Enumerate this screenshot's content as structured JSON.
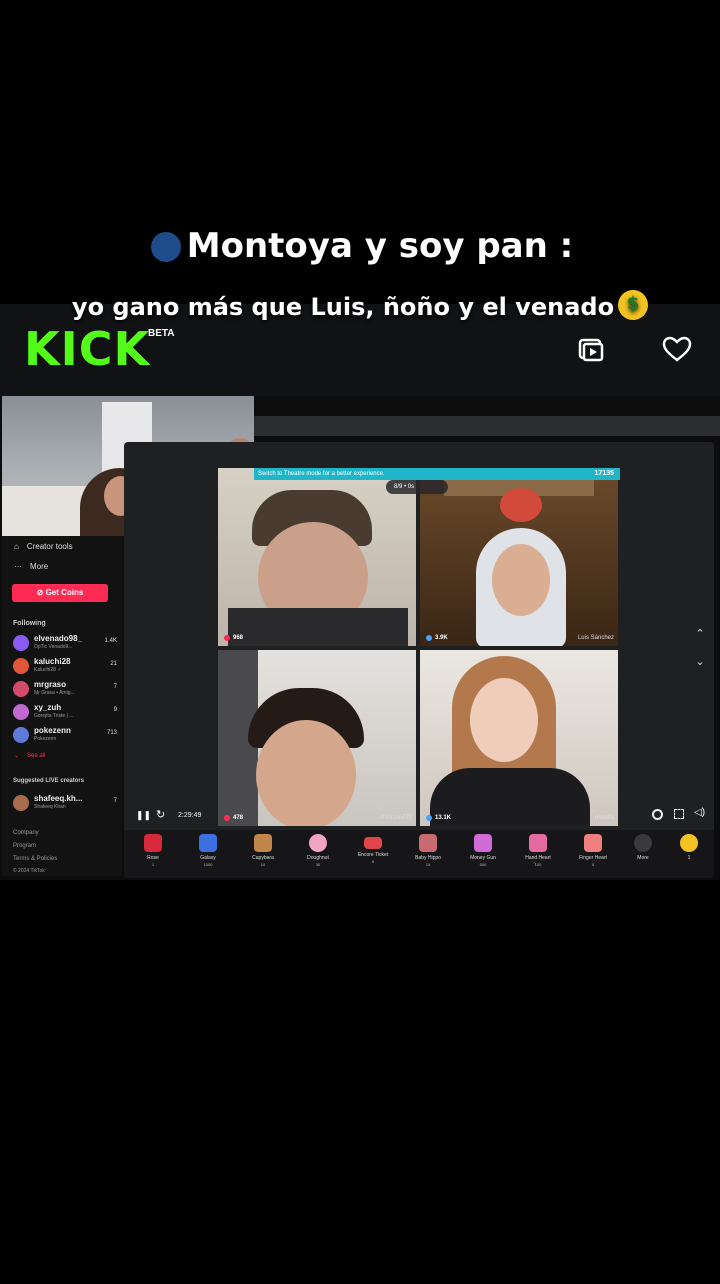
{
  "caption": {
    "line1": "Montoya y soy pan :",
    "line1_emoji": "speaking-head",
    "line2": "yo gano más que Luis, ñoño y el venado",
    "line2_emoji": "money-mouth-face"
  },
  "kick": {
    "logo": "KICK",
    "beta": "BETA",
    "icons": [
      "picture-in-picture-icon",
      "heart-icon"
    ],
    "accent": "#53fc18"
  },
  "sidebar": {
    "creator_tools": "Creator tools",
    "more": "More",
    "get_coins": "Get Coins",
    "following_heading": "Following",
    "following": [
      {
        "name": "elvenado98_",
        "sub": "OpTic Venado9...",
        "count": "1.4K",
        "color": "#8a5cf5"
      },
      {
        "name": "kaluchi28",
        "sub": "Kaluchi28 ✓",
        "count": "21",
        "color": "#e0563a"
      },
      {
        "name": "mrgraso",
        "sub": "Mr Grasa • Amig...",
        "count": "7",
        "color": "#d34b6a"
      },
      {
        "name": "xy_zuh",
        "sub": "Gorejita Triste | ...",
        "count": "9",
        "color": "#c06ad0"
      },
      {
        "name": "pokezenn",
        "sub": "Pokezenn",
        "count": "713",
        "color": "#5f7ad9"
      }
    ],
    "see_all": "See all",
    "suggested_heading": "Suggested LIVE creators",
    "suggested": [
      {
        "name": "shafeeq.kh...",
        "sub": "Shafeeq Khan",
        "count": "7",
        "color": "#a86d4c"
      }
    ],
    "footer": [
      "Company",
      "Program",
      "Terms & Policies",
      "© 2024 TikTok"
    ],
    "accent": "#fe2c55"
  },
  "player": {
    "notice": "Switch to Theatre mode for a better experience.",
    "notice_count": "17135",
    "room_badge": "8/9 • 0s",
    "tiles": [
      {
        "count": "968",
        "name": ""
      },
      {
        "count": "3.9K",
        "name": "Luis Sánchez"
      },
      {
        "count": "478",
        "name": "chinchin777"
      },
      {
        "count": "13.1K",
        "name": "mebilla"
      }
    ],
    "elapsed": "2:29:49",
    "gifts": [
      {
        "name": "Rose",
        "price": "1",
        "color": "#d8283c"
      },
      {
        "name": "Galaxy",
        "price": "1000",
        "color": "#3b6fe0"
      },
      {
        "name": "Capybara",
        "price": "10",
        "color": "#c0864a"
      },
      {
        "name": "Doughnut",
        "price": "30",
        "color": "#f2a5c0"
      },
      {
        "name": "Encore Ticket",
        "price": "5",
        "color": "#e0454a"
      },
      {
        "name": "Baby Hippo",
        "price": "15",
        "color": "#c86a70"
      },
      {
        "name": "Money Gun",
        "price": "500",
        "color": "#d06ad6"
      },
      {
        "name": "Hand Heart",
        "price": "100",
        "color": "#e46aa0"
      },
      {
        "name": "Finger Heart",
        "price": "5",
        "color": "#f08080"
      }
    ],
    "more": "More",
    "coin_balance": "1"
  }
}
